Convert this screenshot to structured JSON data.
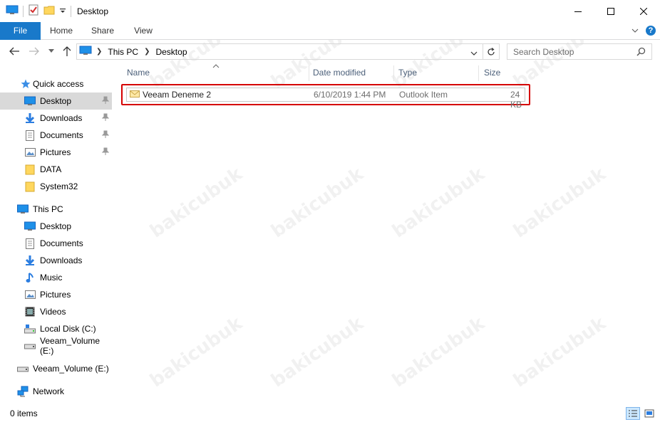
{
  "window": {
    "title": "Desktop"
  },
  "ribbon": {
    "tabs": [
      "File",
      "Home",
      "Share",
      "View"
    ]
  },
  "address": {
    "segments": [
      "This PC",
      "Desktop"
    ]
  },
  "search": {
    "placeholder": "Search Desktop"
  },
  "nav": {
    "quick_access": "Quick access",
    "quick_items": [
      "Desktop",
      "Downloads",
      "Documents",
      "Pictures",
      "DATA",
      "System32"
    ],
    "this_pc": "This PC",
    "pc_items": [
      "Desktop",
      "Documents",
      "Downloads",
      "Music",
      "Pictures",
      "Videos",
      "Local Disk (C:)",
      "Veeam_Volume (E:)"
    ],
    "drive": "Veeam_Volume (E:)",
    "network": "Network"
  },
  "columns": {
    "name": "Name",
    "date": "Date modified",
    "type": "Type",
    "size": "Size"
  },
  "files": [
    {
      "name": "Veeam Deneme 2",
      "date": "6/10/2019 1:44 PM",
      "type": "Outlook Item",
      "size": "24 KB"
    }
  ],
  "status": {
    "count": "0 items"
  },
  "watermark": "bakicubuk",
  "colors": {
    "accent": "#1979ca",
    "highlight": "#d50000"
  }
}
